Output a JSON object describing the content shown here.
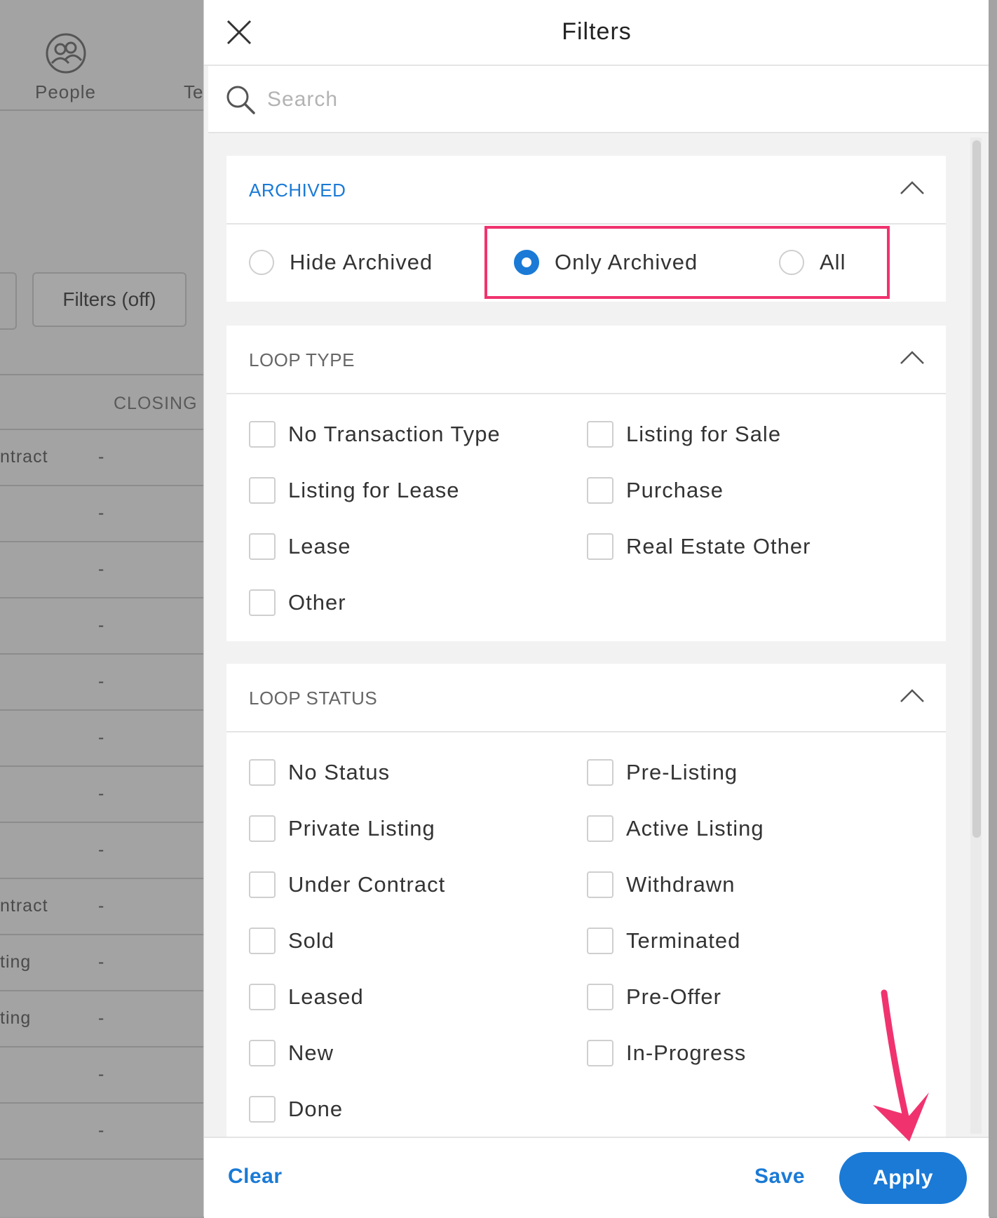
{
  "background": {
    "nav": {
      "people_label": "People",
      "next_label": "Te"
    },
    "filters_button": "Filters (off)",
    "table_header": {
      "closing": "CLOSING"
    },
    "rows": [
      {
        "status": "ntract",
        "closing": "-"
      },
      {
        "status": "",
        "closing": "-"
      },
      {
        "status": "",
        "closing": "-"
      },
      {
        "status": "",
        "closing": "-"
      },
      {
        "status": "",
        "closing": "-"
      },
      {
        "status": "",
        "closing": "-"
      },
      {
        "status": "",
        "closing": "-"
      },
      {
        "status": "",
        "closing": "-"
      },
      {
        "status": "ntract",
        "closing": "-"
      },
      {
        "status": "ting",
        "closing": "-"
      },
      {
        "status": "ting",
        "closing": "-"
      },
      {
        "status": "",
        "closing": "-"
      },
      {
        "status": "",
        "closing": "-"
      }
    ]
  },
  "panel": {
    "title": "Filters",
    "search": {
      "placeholder": "Search",
      "value": ""
    },
    "archived": {
      "title": "ARCHIVED",
      "options": [
        {
          "label": "Hide Archived",
          "checked": false
        },
        {
          "label": "Only Archived",
          "checked": true
        },
        {
          "label": "All",
          "checked": false
        }
      ]
    },
    "loop_type": {
      "title": "LOOP TYPE",
      "options": [
        "No Transaction Type",
        "Listing for Sale",
        "Listing for Lease",
        "Purchase",
        "Lease",
        "Real Estate Other",
        "Other"
      ]
    },
    "loop_status": {
      "title": "LOOP STATUS",
      "options": [
        "No Status",
        "Pre-Listing",
        "Private Listing",
        "Active Listing",
        "Under Contract",
        "Withdrawn",
        "Sold",
        "Terminated",
        "Leased",
        "Pre-Offer",
        "New",
        "In-Progress",
        "Done"
      ]
    },
    "footer": {
      "clear": "Clear",
      "save": "Save",
      "apply": "Apply"
    }
  },
  "colors": {
    "accent": "#1a7ad6",
    "highlight": "#f0336f",
    "arrow": "#f0336f"
  }
}
